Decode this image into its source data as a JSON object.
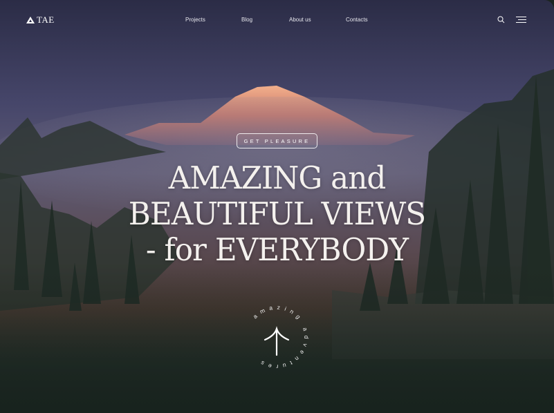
{
  "brand": {
    "name": "TAE"
  },
  "nav": {
    "items": [
      {
        "label": "Projects"
      },
      {
        "label": "Blog"
      },
      {
        "label": "About us"
      },
      {
        "label": "Contacts"
      }
    ]
  },
  "hero": {
    "tag": "GET PLEASURE",
    "headline": [
      "AMAZING and",
      "BEAUTIFUL VIEWS",
      "- for EVERYBODY"
    ],
    "circle_text": "amazing adventures"
  },
  "icons": {
    "search": "search-icon",
    "menu": "menu-icon",
    "scroll": "arrow-up-icon"
  },
  "colors": {
    "sky": "#2f2f4a",
    "forest": "#1e2a24",
    "peak": "#e8a07c"
  }
}
